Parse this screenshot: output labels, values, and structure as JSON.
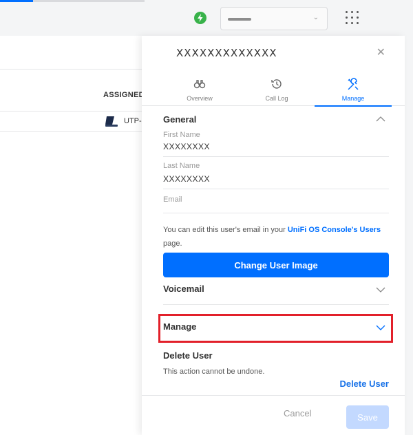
{
  "topbar": {
    "bolt_icon": "lightning-bolt-icon",
    "apps_icon": "apps-grid-icon",
    "accent_color": "#006fff"
  },
  "background_list": {
    "assigned_header": "ASSIGNED",
    "row_device": "UTP-"
  },
  "panel": {
    "title": "XXXXXXXXXXXXX",
    "tabs": [
      {
        "label": "Overview",
        "icon": "binoculars-icon"
      },
      {
        "label": "Call Log",
        "icon": "history-icon"
      },
      {
        "label": "Manage",
        "icon": "tools-icon",
        "active": true
      }
    ],
    "general": {
      "heading": "General",
      "first_name_label": "First Name",
      "first_name_value": "XXXXXXXX",
      "last_name_label": "Last Name",
      "last_name_value": "XXXXXXXX",
      "email_placeholder": "Email",
      "hint_prefix": "You can edit this user's email in your ",
      "hint_link": "UniFi OS Console's Users",
      "hint_suffix": "page.",
      "change_image_button": "Change User Image"
    },
    "voicemail": {
      "heading": "Voicemail"
    },
    "manage": {
      "heading": "Manage"
    },
    "delete": {
      "heading": "Delete User",
      "description": "This action cannot be undone.",
      "link": "Delete User"
    },
    "footer": {
      "cancel": "Cancel",
      "save": "Save"
    }
  },
  "colors": {
    "primary": "#006fff",
    "highlight": "#e2202a",
    "save_disabled": "#c3d9ff"
  }
}
